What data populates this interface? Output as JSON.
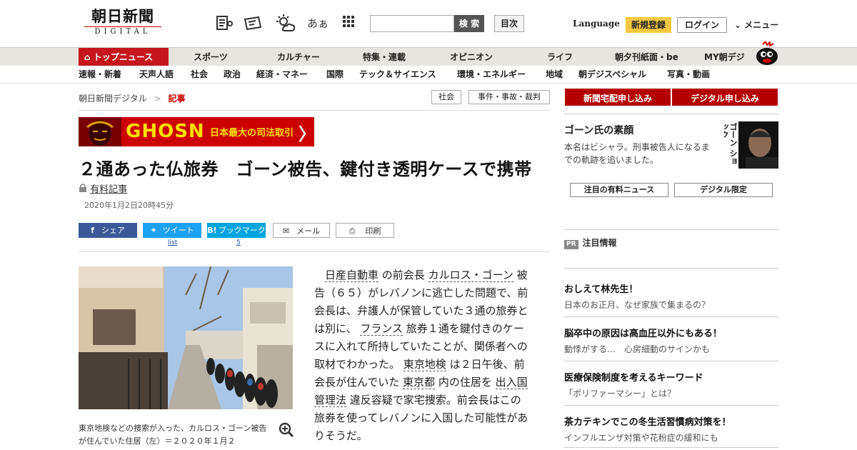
{
  "header": {
    "logo_kanji": "朝日新聞",
    "logo_sub": "DIGITAL",
    "search_button": "検 索",
    "toc_button": "目次",
    "language": "Language",
    "register": "新規登録",
    "login": "ログイン",
    "menu": "メニュー",
    "font_size_label": "あぁ"
  },
  "nav_primary": [
    "トップニュース",
    "スポーツ",
    "カルチャー",
    "特集・連載",
    "オピニオン",
    "ライフ",
    "朝夕刊紙面・be",
    "MY朝デジ"
  ],
  "nav_secondary": [
    "速報・新着",
    "天声人語",
    "社会",
    "政治",
    "経済・マネー",
    "国際",
    "テック＆サイエンス",
    "環境・エネルギー",
    "地域",
    "朝デジスペシャル",
    "写真・動画"
  ],
  "breadcrumb": {
    "home": "朝日新聞デジタル",
    "sep": ">",
    "current": "記事"
  },
  "tags": [
    "社会",
    "事件・事故・裁判"
  ],
  "banner": {
    "ghosn": "GHOSN",
    "text": "日本最大の司法取引",
    "arrow": "〉"
  },
  "article": {
    "title": "２通あった仏旅券　ゴーン被告、鍵付き透明ケースで携帯",
    "paid_label": "有料記事",
    "date": "2020年1月2日20時45分",
    "share": {
      "facebook": "シェア",
      "twitter": "ツイート",
      "hatena": "ブックマーク",
      "mail": "メール",
      "print": "印刷"
    },
    "twitter_count": "list",
    "hatena_count": "5",
    "caption": "東京地検などの捜索が入った、カルロス・ゴーン被告が住んでいた住居（左）＝２０２０年１月２",
    "body_segments": [
      {
        "text": "日産自動車",
        "link": true
      },
      {
        "text": " の前会長 ",
        "link": false
      },
      {
        "text": "カルロス・ゴーン",
        "link": true
      },
      {
        "text": " 被告（６５）がレバノンに逃亡した問題で、前会長は、弁護人が保管していた３通の旅券とは別に、 ",
        "link": false
      },
      {
        "text": "フランス",
        "link": true
      },
      {
        "text": " 旅券１通を鍵付きのケースに入れて所持していたことが、関係者への取材でわかった。 ",
        "link": false
      },
      {
        "text": "東京地検",
        "link": true
      },
      {
        "text": " は２日午後、前会長が住んでいた ",
        "link": false
      },
      {
        "text": "東京都",
        "link": true
      },
      {
        "text": " 内の住居を ",
        "link": false
      },
      {
        "text": "出入国管理法",
        "link": true
      },
      {
        "text": " 違反容疑で家宅捜索。前会長はこの旅券を使ってレバノンに入国した可能性がありそうだ。",
        "link": false
      }
    ]
  },
  "sidebar": {
    "subscribe_paper": "新聞宅配申し込み",
    "subscribe_digital": "デジタル申し込み",
    "profile_title": "ゴーン氏の素顔",
    "profile_text": "本名はビシャラ。刑事被告人になるまでの軌跡を追いました。",
    "profile_image_text": "ゴーン ショック",
    "button_paid_news": "注目の有料ニュース",
    "button_digital_only": "デジタル限定",
    "pr_badge": "PR",
    "pr_heading": "注目情報",
    "pr_items": [
      {
        "title": "おしえて林先生！",
        "desc": "日本のお正月、なぜ家族で集まるの？"
      },
      {
        "title": "脳卒中の原因は高血圧以外にもある！",
        "desc": "動悸がする…　心房細動のサインかも"
      },
      {
        "title": "医療保険制度を考えるキーワード",
        "desc": "「ポリファーマシー」とは？"
      },
      {
        "title": "茶カテキンでこの冬生活習慣病対策を！",
        "desc": "インフルエンザ対策や花粉症の緩和にも"
      }
    ]
  },
  "colors": {
    "brand_red": "#c4161c",
    "nav_bg": "#e7e5df",
    "register_yellow": "#f6c842",
    "facebook": "#3b5998",
    "twitter": "#1da1f2",
    "hatena": "#00a4de"
  }
}
